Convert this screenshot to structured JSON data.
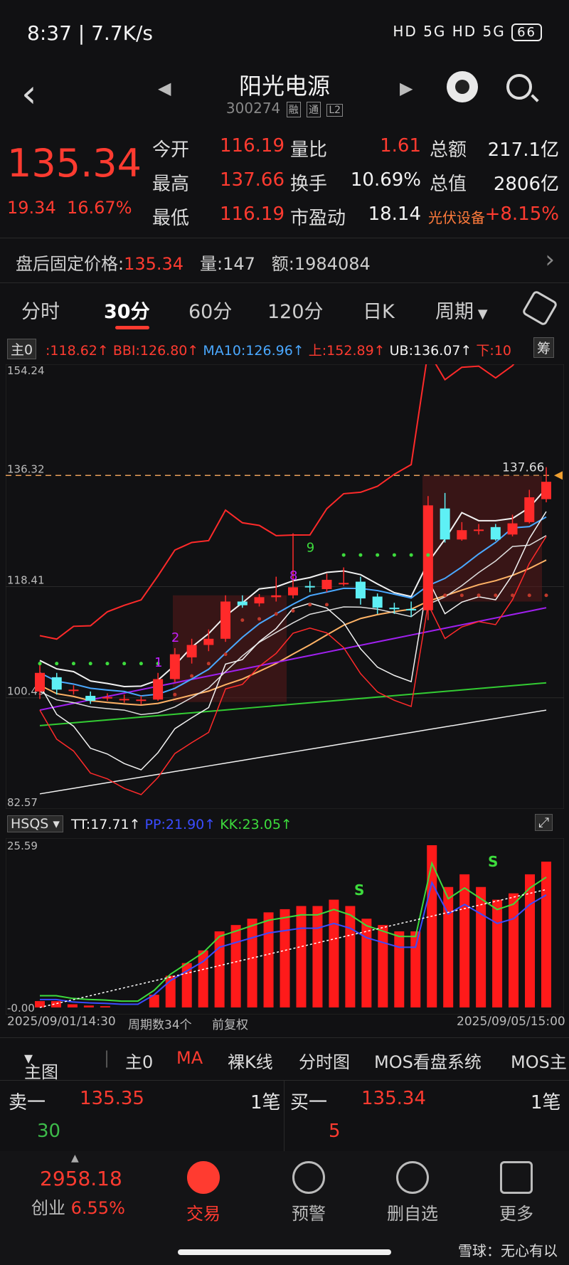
{
  "status_bar": {
    "time": "8:37 | 7.7K/s",
    "right_icons": "HD 5G HD 5G",
    "battery": "66"
  },
  "header": {
    "title": "阳光电源",
    "code": "300274",
    "tags": [
      "融",
      "通",
      "L2"
    ]
  },
  "quote": {
    "price": "135.34",
    "change": "19.34",
    "change_pct": "16.67%",
    "fields": [
      {
        "label": "今开",
        "value": "116.19",
        "label2": "量比",
        "value2": "1.61",
        "label3": "总额",
        "value3": "217.1亿"
      },
      {
        "label": "最高",
        "value": "137.66",
        "label2": "换手",
        "value2": "10.69%",
        "label3": "总值",
        "value3": "2806亿"
      },
      {
        "label": "最低",
        "value": "116.19",
        "label2": "市盈动",
        "value2": "18.14",
        "label3": "光伏设备",
        "value3": "+8.15%"
      }
    ]
  },
  "after_hours": {
    "label": "盘后固定价格:",
    "price": "135.34",
    "vol_label": "量:",
    "vol": "147",
    "amt_label": "额:",
    "amt": "1984084"
  },
  "tabs": [
    "分时",
    "30分",
    "60分",
    "120分",
    "日K",
    "周期"
  ],
  "active_tab": "30分",
  "legend_main": {
    "selector": "主0",
    "items": [
      {
        "text": ":118.62↑",
        "color": "#ff3b30"
      },
      {
        "text": "BBI:126.80↑",
        "color": "#ff3b30"
      },
      {
        "text": "MA10:126.96↑",
        "color": "#4aa8ff"
      },
      {
        "text": "上:152.89↑",
        "color": "#ff3b30"
      },
      {
        "text": "UB:136.07↑",
        "color": "#f2f2f2"
      },
      {
        "text": "下:10",
        "color": "#ff3b30"
      }
    ],
    "right_chip": "筹"
  },
  "chart_data": {
    "type": "candlestick",
    "y_top_label": "154.24",
    "y_mid_label": "136.32",
    "y_118_label": "118.41",
    "y_100_label": "100.49",
    "y_bottom_label": "82.57",
    "ylim": [
      82.57,
      154.24
    ],
    "high_marker": "137.66",
    "dashed_level": 136.32,
    "candles": [
      {
        "o": 101.5,
        "c": 104.5,
        "h": 106,
        "l": 100.3
      },
      {
        "o": 103.8,
        "c": 101.8,
        "h": 104.5,
        "l": 101
      },
      {
        "o": 101.6,
        "c": 101.8,
        "h": 102.5,
        "l": 101
      },
      {
        "o": 100.8,
        "c": 100.0,
        "h": 101.5,
        "l": 99.5
      },
      {
        "o": 100.4,
        "c": 100.6,
        "h": 101.2,
        "l": 100.0
      },
      {
        "o": 100.2,
        "c": 100.3,
        "h": 101,
        "l": 99.7
      },
      {
        "o": 100.0,
        "c": 100.2,
        "h": 100.8,
        "l": 99.4
      },
      {
        "o": 100.2,
        "c": 103.5,
        "h": 104.5,
        "l": 100.0
      },
      {
        "o": 103.5,
        "c": 107.5,
        "h": 108.5,
        "l": 103
      },
      {
        "o": 107.0,
        "c": 109.0,
        "h": 110,
        "l": 106
      },
      {
        "o": 109.0,
        "c": 110.0,
        "h": 111.5,
        "l": 108
      },
      {
        "o": 110.0,
        "c": 116.0,
        "h": 117,
        "l": 109.5
      },
      {
        "o": 116.0,
        "c": 115.4,
        "h": 117,
        "l": 115
      },
      {
        "o": 115.7,
        "c": 116.7,
        "h": 117.2,
        "l": 115.2
      },
      {
        "o": 116.7,
        "c": 117.0,
        "h": 120,
        "l": 116
      },
      {
        "o": 117.0,
        "c": 118.3,
        "h": 127,
        "l": 116.5
      },
      {
        "o": 118.5,
        "c": 118.3,
        "h": 119.3,
        "l": 117.5
      },
      {
        "o": 118.0,
        "c": 119.5,
        "h": 120.5,
        "l": 117.5
      },
      {
        "o": 119.0,
        "c": 119.0,
        "h": 121.5,
        "l": 118.5
      },
      {
        "o": 119.2,
        "c": 116.5,
        "h": 120,
        "l": 115.5
      },
      {
        "o": 116.8,
        "c": 115.0,
        "h": 117.3,
        "l": 114
      },
      {
        "o": 115.0,
        "c": 114.8,
        "h": 115.8,
        "l": 114
      },
      {
        "o": 114.8,
        "c": 114.6,
        "h": 116,
        "l": 113.5
      },
      {
        "o": 114.6,
        "c": 131.5,
        "h": 133,
        "l": 113
      },
      {
        "o": 131.0,
        "c": 126.0,
        "h": 133.5,
        "l": 125.5
      },
      {
        "o": 126.0,
        "c": 127.5,
        "h": 128.8,
        "l": 125.8
      },
      {
        "o": 127.5,
        "c": 127.6,
        "h": 128.5,
        "l": 126.8
      },
      {
        "o": 128.0,
        "c": 126.0,
        "h": 128.5,
        "l": 125.8
      },
      {
        "o": 126.8,
        "c": 128.6,
        "h": 130,
        "l": 126.5
      },
      {
        "o": 128.8,
        "c": 132.8,
        "h": 134,
        "l": 128.6
      },
      {
        "o": 132.5,
        "c": 135.3,
        "h": 137.66,
        "l": 132
      }
    ],
    "labels": [
      "1",
      "2",
      "8",
      "9"
    ]
  },
  "legend_sub": {
    "selector": "HSQS",
    "items": [
      {
        "text": "TT:17.71↑",
        "color": "#f2f2f2"
      },
      {
        "text": "PP:21.90↑",
        "color": "#3a4cff"
      },
      {
        "text": "KK:23.05↑",
        "color": "#3ddc3d"
      }
    ],
    "y_top": "25.59",
    "y_bottom": "-0.00",
    "markers": [
      "S",
      "S"
    ]
  },
  "sub_chart_data": {
    "bars": [
      1,
      1,
      0.5,
      0.3,
      0.2,
      0,
      0,
      2,
      5,
      7,
      9,
      12,
      13,
      14,
      15,
      15.5,
      16,
      16,
      17,
      16,
      14,
      13,
      12,
      12,
      25.59,
      19,
      21,
      19,
      17,
      18,
      21,
      23
    ]
  },
  "axis_footer": {
    "left": "2025/09/01/14:30",
    "count": "周期数34个",
    "adj": "前复权",
    "right": "2025/09/05/15:00"
  },
  "indicator_menu": [
    "主图",
    "主0",
    "MA",
    "裸K线",
    "分时图",
    "MOS看盘系统",
    "MOS主"
  ],
  "order_book": {
    "sell_label": "卖一",
    "sell_price": "135.35",
    "sell_count": "1笔",
    "sell_vol": "30",
    "buy_label": "买一",
    "buy_price": "135.34",
    "buy_count": "1笔",
    "buy_vol": "5"
  },
  "bottom_nav": {
    "index_value": "2958.18",
    "index_name": "创业",
    "index_pct": "6.55%",
    "items": [
      "交易",
      "预警",
      "删自选",
      "更多"
    ]
  },
  "watermark": "雪球：无心有以"
}
